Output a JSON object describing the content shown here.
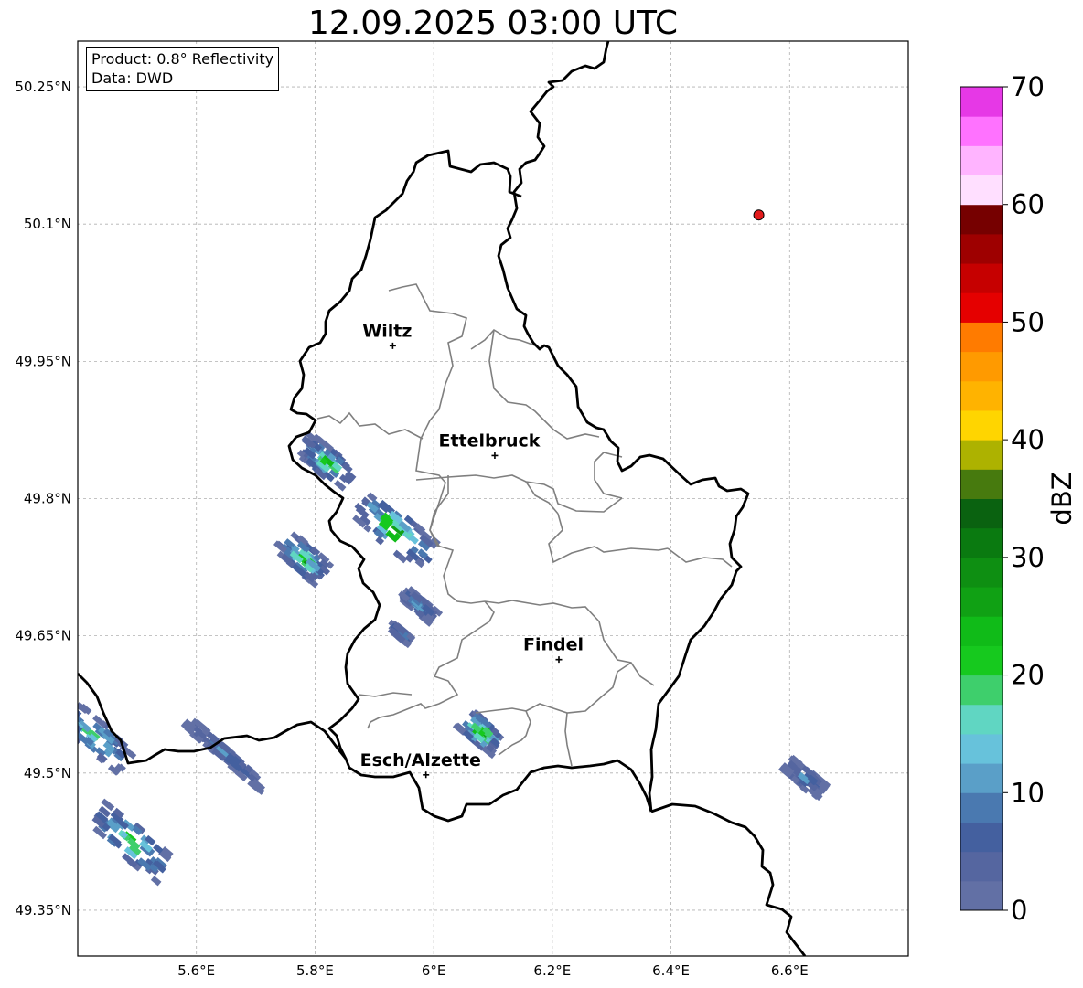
{
  "title": "12.09.2025 03:00 UTC",
  "info_box": {
    "product": "Product: 0.8° Reflectivity",
    "data_source": "Data: DWD"
  },
  "axes": {
    "lon_range": [
      5.4,
      6.8
    ],
    "lat_range": [
      49.3,
      50.3
    ],
    "lon_ticks": [
      {
        "value": 5.6,
        "label": "5.6°E"
      },
      {
        "value": 5.8,
        "label": "5.8°E"
      },
      {
        "value": 6.0,
        "label": "6°E"
      },
      {
        "value": 6.2,
        "label": "6.2°E"
      },
      {
        "value": 6.4,
        "label": "6.4°E"
      },
      {
        "value": 6.6,
        "label": "6.6°E"
      }
    ],
    "lat_ticks": [
      {
        "value": 49.35,
        "label": "49.35°N"
      },
      {
        "value": 49.5,
        "label": "49.5°N"
      },
      {
        "value": 49.65,
        "label": "49.65°N"
      },
      {
        "value": 49.8,
        "label": "49.8°N"
      },
      {
        "value": 49.95,
        "label": "49.95°N"
      },
      {
        "value": 50.1,
        "label": "50.1°N"
      },
      {
        "value": 50.25,
        "label": "50.25°N"
      }
    ],
    "grid": true
  },
  "cities": [
    {
      "name": "Wiltz",
      "lon": 5.931,
      "lat": 49.967
    },
    {
      "name": "Ettelbruck",
      "lon": 6.103,
      "lat": 49.847
    },
    {
      "name": "Findel",
      "lon": 6.211,
      "lat": 49.624
    },
    {
      "name": "Esch/Alzette",
      "lon": 5.987,
      "lat": 49.498
    }
  ],
  "radar_site": {
    "lon": 6.548,
    "lat": 50.11,
    "color": "#e31a1c"
  },
  "colorbar": {
    "label": "dBZ",
    "min": 0,
    "max": 70,
    "step": 2.5,
    "tick_values": [
      0,
      10,
      20,
      30,
      40,
      50,
      60,
      70
    ],
    "colors": [
      "#6270a5",
      "#5566a0",
      "#44609f",
      "#4a79b0",
      "#5a9fc8",
      "#67c2db",
      "#60d6c2",
      "#3ecf6c",
      "#16c91e",
      "#10bb18",
      "#10a114",
      "#0e8f12",
      "#0a7a10",
      "#0a6210",
      "#477a0e",
      "#adb200",
      "#ffd500",
      "#ffb300",
      "#ff9a00",
      "#ff7b00",
      "#e50000",
      "#c60000",
      "#9e0000",
      "#760000",
      "#ffdfff",
      "#ffb4ff",
      "#ff72ff",
      "#e638e6"
    ]
  },
  "reflectivity_cells": [
    {
      "name": "cell-northwest",
      "lon": 5.82,
      "lat": 49.84,
      "len": 0.1,
      "wid": 0.045,
      "peak_dbz": 24
    },
    {
      "name": "cell-central-west",
      "lon": 5.935,
      "lat": 49.765,
      "len": 0.14,
      "wid": 0.06,
      "peak_dbz": 30
    },
    {
      "name": "cell-west-small",
      "lon": 5.78,
      "lat": 49.735,
      "len": 0.085,
      "wid": 0.045,
      "peak_dbz": 28
    },
    {
      "name": "cell-tail",
      "lon": 5.975,
      "lat": 49.683,
      "len": 0.06,
      "wid": 0.025,
      "peak_dbz": 14
    },
    {
      "name": "cell-tiny",
      "lon": 5.945,
      "lat": 49.652,
      "len": 0.035,
      "wid": 0.015,
      "peak_dbz": 15
    },
    {
      "name": "cell-esch-north",
      "lon": 6.08,
      "lat": 49.545,
      "len": 0.065,
      "wid": 0.04,
      "peak_dbz": 36
    },
    {
      "name": "cell-far-east",
      "lon": 6.625,
      "lat": 49.495,
      "len": 0.07,
      "wid": 0.03,
      "peak_dbz": 12
    },
    {
      "name": "cell-belgium-sw",
      "lon": 5.49,
      "lat": 49.425,
      "len": 0.15,
      "wid": 0.055,
      "peak_dbz": 26
    },
    {
      "name": "cell-edge-west",
      "lon": 5.43,
      "lat": 49.54,
      "len": 0.14,
      "wid": 0.05,
      "peak_dbz": 22
    },
    {
      "name": "cell-south-band",
      "lon": 5.65,
      "lat": 49.52,
      "len": 0.17,
      "wid": 0.022,
      "peak_dbz": 11
    }
  ]
}
